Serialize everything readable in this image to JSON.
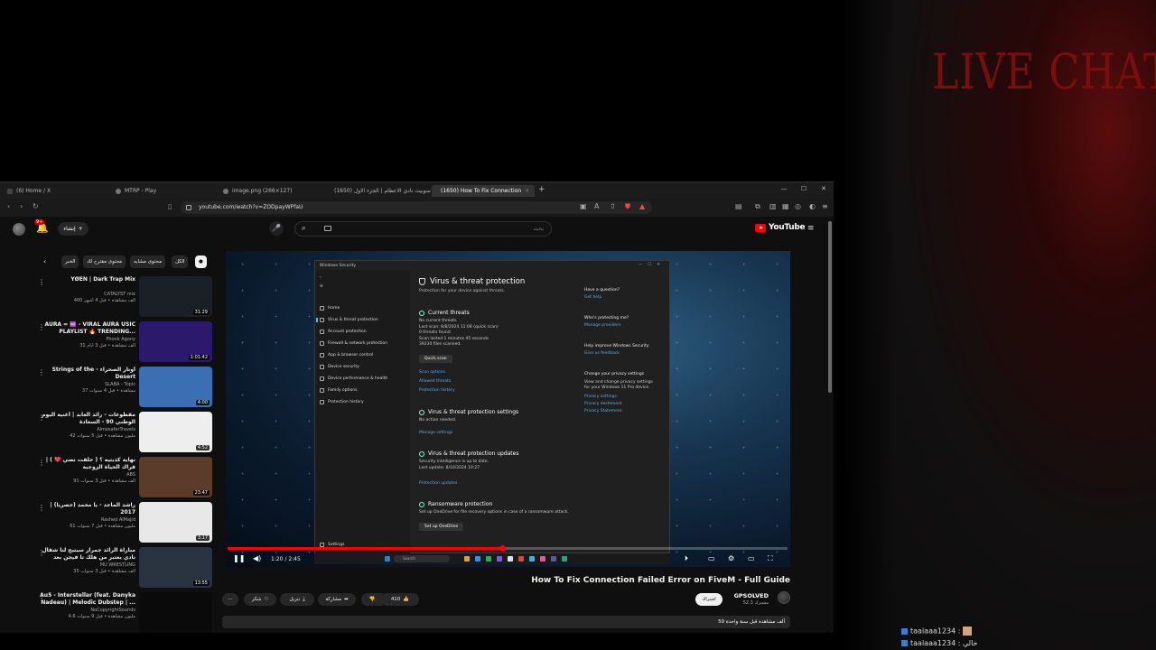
{
  "overlay": {
    "live_chat_title": "LIVE CHAT",
    "chat": [
      {
        "user": "taalaaa1234 :",
        "message": ""
      },
      {
        "user": "taalaaa1234 :",
        "message": "خالي"
      }
    ]
  },
  "browser": {
    "tabs": [
      {
        "label": "(6) Home / X",
        "favicon": "x-icon"
      },
      {
        "label": "MTRP - Play",
        "favicon": "globe-icon"
      },
      {
        "label": "image.png (266×127)",
        "favicon": "globe-icon"
      },
      {
        "label": "(1650) سوبيت نادي الاعظام | الجزء الاول",
        "favicon": "youtube-icon"
      },
      {
        "label": "(1650) How To Fix Connection",
        "favicon": "youtube-icon",
        "active": true
      }
    ],
    "url": "youtube.com/watch?v=ZODpayWPfaU",
    "accent": "#ff0000"
  },
  "youtube": {
    "notifications_badge": "9+",
    "create_label": "إنشاء",
    "search_placeholder": "بحث",
    "logo_text": "YouTube",
    "chips": [
      "الكل",
      "محتوى مشابه",
      "محتوى مقترح لك",
      "الخبر"
    ],
    "recommendations": [
      {
        "title": "YØEN | Dark Trap Mix",
        "channel": "CATALYST mix",
        "meta": "400 ألف مشاهدة • قبل 4 أشهر",
        "duration": "31:29",
        "color": "#1b1f26"
      },
      {
        "title": "AURA = ♾️ - VIRAL AURA USIC PLAYLIST 🔥 TRENDING...",
        "channel": "Phonk Agony",
        "meta": "31 ألف مشاهدة • قبل 3 أيام",
        "duration": "1:01:42",
        "color": "#2b1a6b",
        "badge": "جديد"
      },
      {
        "title": "Strings of the - أوتار الصحراء Desert",
        "channel": "SLABA - Topic",
        "meta": "37 مشاهدة • قبل 4 سنوات",
        "duration": "4:00",
        "color": "#3a6fb3",
        "badge": "جديد"
      },
      {
        "title": "مقطوعات - رائد العابد | أغنية اليوم الوطني 90 - السعادة",
        "channel": "AlmosaferTravels",
        "meta": "42 مليون مشاهدة • قبل 5 سنوات",
        "duration": "4:52",
        "color": "#eeeeee",
        "badge": "جديد"
      },
      {
        "title": "نهاية كذبتيه ؟ ( حلقت نصي ❤️ ) | فراك الحياة الزوجية",
        "channel": "ABS",
        "meta": "91 ألف مشاهدة • قبل 3 سنوات",
        "duration": "23:47",
        "color": "#5b3b2a"
      },
      {
        "title": "راشد الماجد - يا محمد (حصرياً) | 2017",
        "channel": "Rashed AlMajid",
        "meta": "61 مليون مشاهدة • قبل 7 سنوات",
        "duration": "3:17",
        "color": "#e8e8e8"
      },
      {
        "title": "مباراة الرائد جمرار سيتيح لنا شقال نادي يعتبر من هلك تا فيجن بعد الانطلاب على ميزبت",
        "channel": "MU WRESTLING",
        "meta": "35 ألف مشاهدة • قبل 3 سنوات",
        "duration": "13:55",
        "color": "#2a3440"
      },
      {
        "title": "Au5 - Interstellar (feat. Danyka Nadeau) | Melodic Dubstep | ...",
        "channel": "NoCopyrightSounds",
        "meta": "4.6 مليون مشاهدة • قبل 9 سنوات",
        "duration": "",
        "color": "#0a0a0a"
      }
    ],
    "video": {
      "title": "How To Fix Connection Failed Error on FiveM - Full Guide",
      "current_time": "1:20",
      "duration": "2:45",
      "progress_fraction": 0.49,
      "channel": "GPSOLVED",
      "subscribers": "52.3 مشترك",
      "subscribe_label": "اشتراك",
      "likes": "410",
      "share_label": "مشاركة",
      "download_label": "تنزيل",
      "clip_label": "شكر",
      "description": "50 ألف مشاهدة قبل سنة واحدة"
    },
    "screen": {
      "window_title": "Windows Security",
      "nav": [
        "Home",
        "Virus & threat protection",
        "Account protection",
        "Firewall & network protection",
        "App & browser control",
        "Device security",
        "Device performance & health",
        "Family options",
        "Protection history"
      ],
      "settings_label": "Settings",
      "heading": "Virus & threat protection",
      "subheading": "Protection for your device against threats.",
      "current_threats": "Current threats",
      "threats_text": "No current threats.\nLast scan: 8/8/2024 11:08 (quick scan)\n0 threats found.\nScan lasted 1 minutes 45 seconds\n39230 files scanned.",
      "quick_scan": "Quick scan",
      "links_a": [
        "Scan options",
        "Allowed threats",
        "Protection history"
      ],
      "settings_heading": "Virus & threat protection settings",
      "settings_text": "No action needed.",
      "manage_settings": "Manage settings",
      "updates_heading": "Virus & threat protection updates",
      "updates_text": "Security intelligence is up to date.\nLast update: 8/10/2024 10:27",
      "protection_updates": "Protection updates",
      "ransom_heading": "Ransomware protection",
      "ransom_text": "Set up OneDrive for file recovery options in case of a ransomware attack.",
      "onedrive_btn": "Set up OneDrive",
      "right": {
        "q_heading": "Have a question?",
        "q_link": "Get help",
        "who_heading": "Who's protecting me?",
        "who_link": "Manage providers",
        "improve_heading": "Help improve Windows Security",
        "improve_link": "Give us feedback",
        "privacy_heading": "Change your privacy settings",
        "privacy_text": "View and change privacy settings\nfor your Windows 11 Pro device.",
        "privacy_links": [
          "Privacy settings",
          "Privacy dashboard",
          "Privacy Statement"
        ]
      },
      "taskbar_search": "Search"
    }
  }
}
